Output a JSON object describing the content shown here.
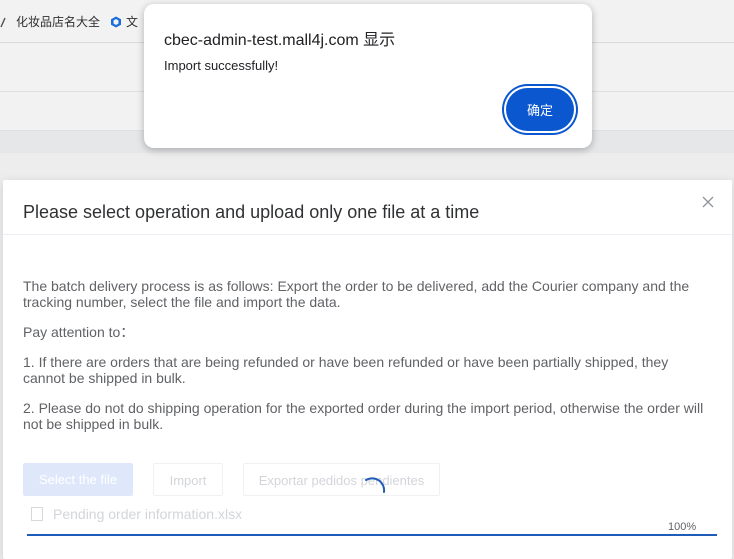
{
  "browser": {
    "bookmarks": [
      {
        "label": "化妆品店名大全",
        "icon": "bookmark-folder-icon"
      },
      {
        "label": "文",
        "icon": "cube-icon"
      }
    ]
  },
  "modal": {
    "title": "Please select operation and upload only one file at a time",
    "close_icon": "close-icon",
    "paragraphs": [
      "The batch delivery process is as follows: Export the order to be delivered, add the Courier company and the tracking number, select the file and import the data.",
      "Pay attention to：",
      "1. If there are orders that are being refunded or have been refunded or have been partially shipped, they cannot be shipped in bulk.",
      "2. Please do not do shipping operation for the exported order during the import period, otherwise the order will not be shipped in bulk."
    ],
    "buttons": {
      "select_file": "Select the file",
      "import": "Import",
      "export": "Exportar pedidos pendientes"
    },
    "file": {
      "name": "Pending order information.xlsx",
      "icon": "document-icon",
      "progress_percent": 100,
      "progress_label": "100%"
    },
    "loading_icon": "spinner-icon"
  },
  "alert": {
    "title": "cbec-admin-test.mall4j.com 显示",
    "message": "Import successfully!",
    "ok_label": "确定",
    "accent": "#0b57d0"
  }
}
